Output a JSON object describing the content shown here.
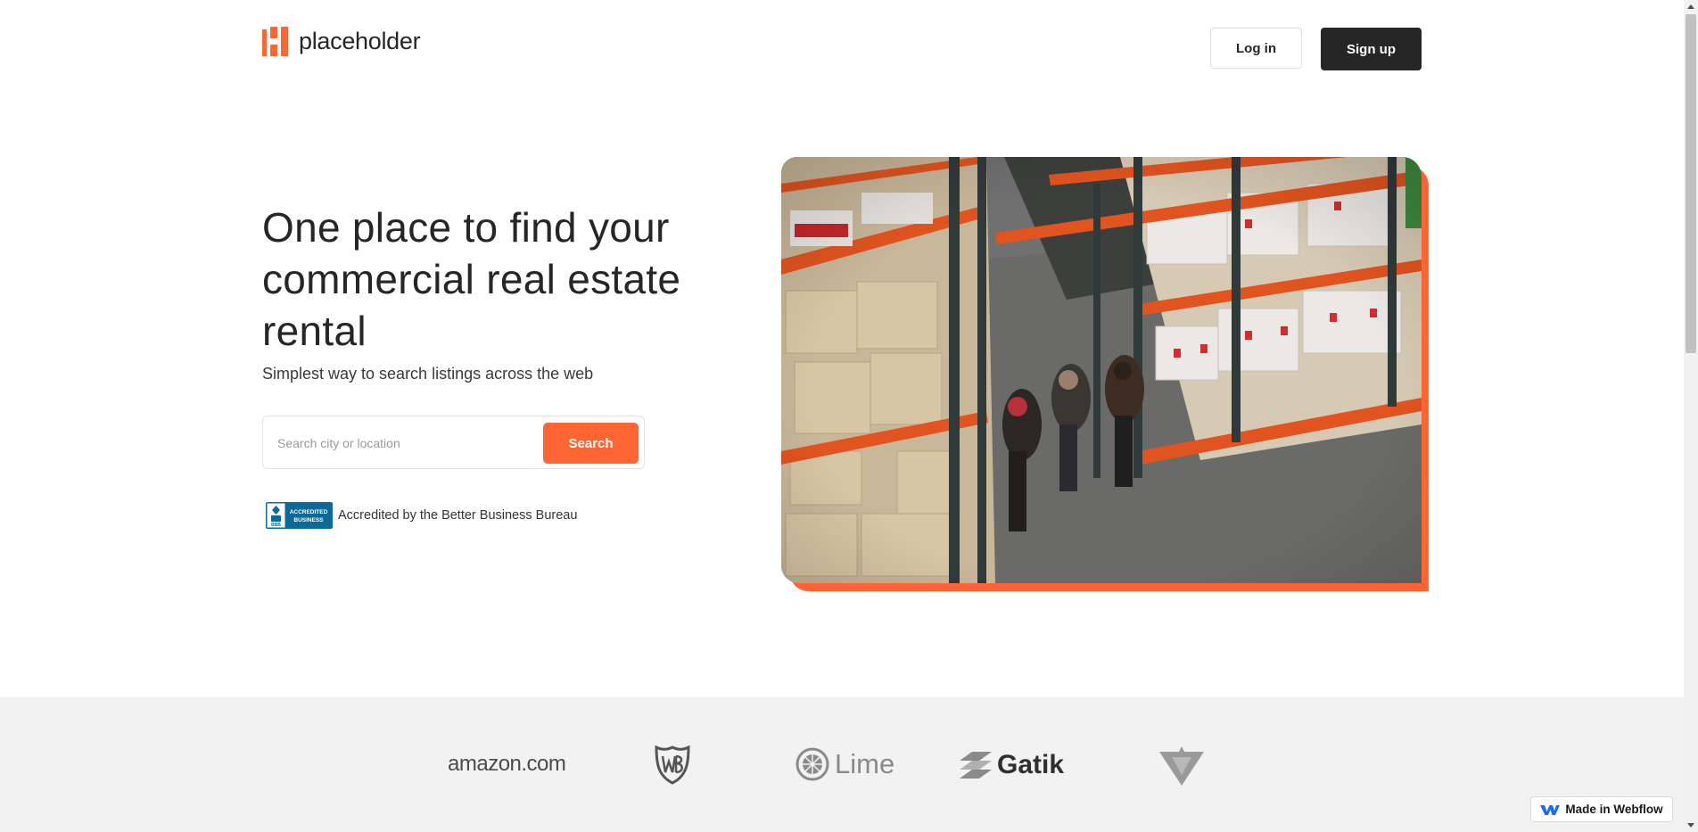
{
  "header": {
    "brand_name": "placeholder",
    "login_label": "Log in",
    "signup_label": "Sign up"
  },
  "hero": {
    "title": "One place to find your commercial real estate rental",
    "subtitle": "Simplest way to search listings across the web",
    "search": {
      "placeholder": "Search city or location",
      "value": "",
      "button_label": "Search"
    },
    "accreditation": {
      "badge_lines": [
        "ACCREDITED",
        "BUSINESS"
      ],
      "badge_logo_text": "BBB",
      "text": "Accredited by the Better Business Bureau"
    },
    "image": "warehouse-photo"
  },
  "brands": {
    "amazon": "amazon.com",
    "lime": "Lime",
    "gatik": "Gatik",
    "wb_icon": "wb-shield-logo",
    "canadian_tire_icon": "canadian-tire-logo"
  },
  "webflow_badge": "Made in Webflow",
  "colors": {
    "accent": "#ff6533",
    "dark": "#262626",
    "strip_bg": "#f2f2f2"
  }
}
